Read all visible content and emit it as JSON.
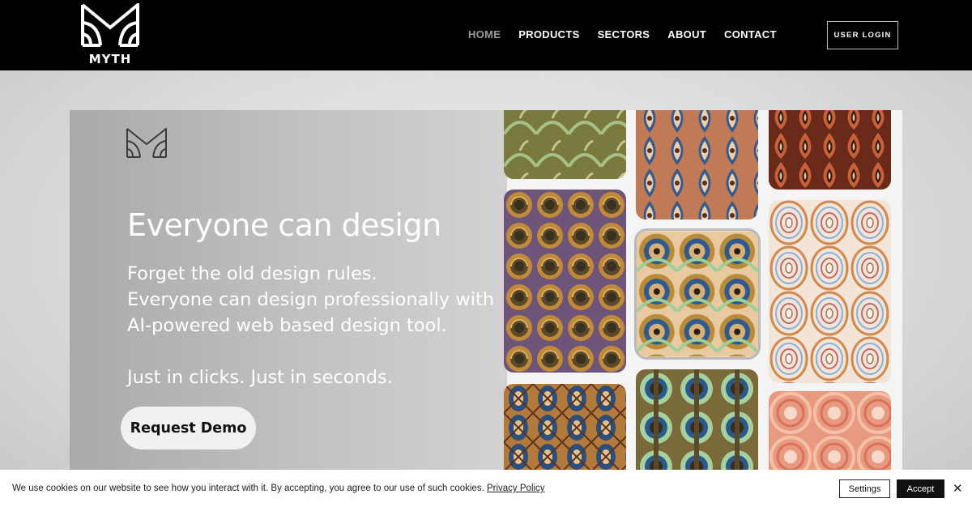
{
  "header": {
    "logo_text": "MYTH",
    "nav": [
      {
        "label": "HOME",
        "active": true
      },
      {
        "label": "PRODUCTS",
        "active": false
      },
      {
        "label": "SECTORS",
        "active": false
      },
      {
        "label": "ABOUT",
        "active": false
      },
      {
        "label": "CONTACT",
        "active": false
      }
    ],
    "login_label": "USER LOGIN"
  },
  "hero": {
    "title": "Everyone can design",
    "lines": [
      "Forget the old design rules.",
      "Everyone can design professionally with",
      "AI-powered web based design tool."
    ],
    "tagline": "Just in clicks. Just in seconds.",
    "cta_label": "Request Demo"
  },
  "cookie": {
    "text": "We use cookies on our website to see how you interact with it. By accepting, you agree to our use of such cookies.",
    "policy_link": "Privacy Policy",
    "settings_label": "Settings",
    "accept_label": "Accept",
    "close_glyph": "✕"
  },
  "colors": {
    "header_bg": "#000000",
    "nav_active": "#9a9a9a",
    "accept_bg": "#111111"
  }
}
